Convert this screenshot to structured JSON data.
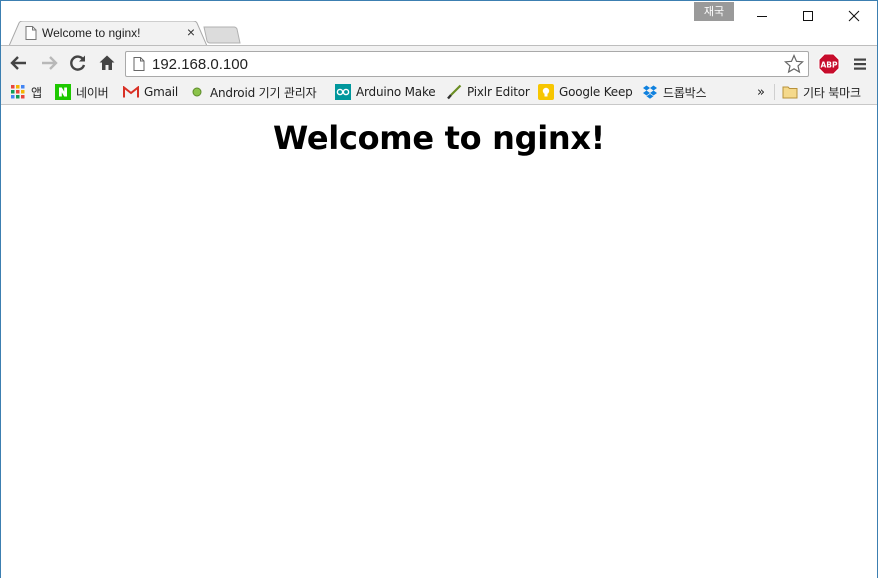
{
  "browser": {
    "profile_badge": "재국",
    "tab": {
      "title": "Welcome to nginx!",
      "close_glyph": "×"
    },
    "omnibox": {
      "url": "192.168.0.100"
    },
    "abp_label": "ABP",
    "bookmarks": [
      {
        "label": "앱"
      },
      {
        "label": "네이버"
      },
      {
        "label": "Gmail"
      },
      {
        "label": "Android 기기 관리자"
      },
      {
        "label": "Arduino Make"
      },
      {
        "label": "Pixlr Editor"
      },
      {
        "label": "Google Keep"
      },
      {
        "label": "드롭박스"
      }
    ],
    "bookmarks_more": "»",
    "other_bookmarks": "기타 북마크"
  },
  "page": {
    "heading": "Welcome to nginx!"
  },
  "colors": {
    "window_border": "#3c7fb1",
    "toolbar_bg": "#f2f2f2",
    "naver_green": "#1ec800",
    "abp_red": "#c70d2c",
    "arduino_teal": "#00979c",
    "keep_yellow": "#f7c600",
    "dropbox_blue": "#1081de"
  }
}
